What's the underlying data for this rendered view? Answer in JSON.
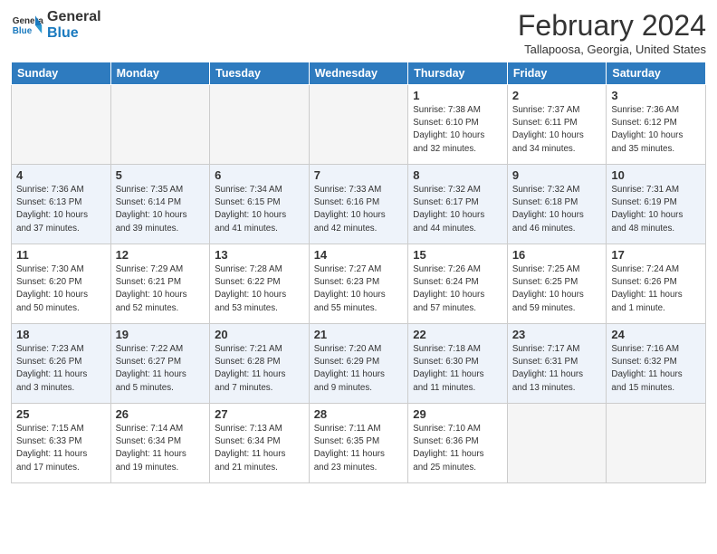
{
  "header": {
    "logo_line1": "General",
    "logo_line2": "Blue",
    "month_title": "February 2024",
    "location": "Tallapoosa, Georgia, United States"
  },
  "days_of_week": [
    "Sunday",
    "Monday",
    "Tuesday",
    "Wednesday",
    "Thursday",
    "Friday",
    "Saturday"
  ],
  "weeks": [
    [
      {
        "day": "",
        "info": ""
      },
      {
        "day": "",
        "info": ""
      },
      {
        "day": "",
        "info": ""
      },
      {
        "day": "",
        "info": ""
      },
      {
        "day": "1",
        "info": "Sunrise: 7:38 AM\nSunset: 6:10 PM\nDaylight: 10 hours\nand 32 minutes."
      },
      {
        "day": "2",
        "info": "Sunrise: 7:37 AM\nSunset: 6:11 PM\nDaylight: 10 hours\nand 34 minutes."
      },
      {
        "day": "3",
        "info": "Sunrise: 7:36 AM\nSunset: 6:12 PM\nDaylight: 10 hours\nand 35 minutes."
      }
    ],
    [
      {
        "day": "4",
        "info": "Sunrise: 7:36 AM\nSunset: 6:13 PM\nDaylight: 10 hours\nand 37 minutes."
      },
      {
        "day": "5",
        "info": "Sunrise: 7:35 AM\nSunset: 6:14 PM\nDaylight: 10 hours\nand 39 minutes."
      },
      {
        "day": "6",
        "info": "Sunrise: 7:34 AM\nSunset: 6:15 PM\nDaylight: 10 hours\nand 41 minutes."
      },
      {
        "day": "7",
        "info": "Sunrise: 7:33 AM\nSunset: 6:16 PM\nDaylight: 10 hours\nand 42 minutes."
      },
      {
        "day": "8",
        "info": "Sunrise: 7:32 AM\nSunset: 6:17 PM\nDaylight: 10 hours\nand 44 minutes."
      },
      {
        "day": "9",
        "info": "Sunrise: 7:32 AM\nSunset: 6:18 PM\nDaylight: 10 hours\nand 46 minutes."
      },
      {
        "day": "10",
        "info": "Sunrise: 7:31 AM\nSunset: 6:19 PM\nDaylight: 10 hours\nand 48 minutes."
      }
    ],
    [
      {
        "day": "11",
        "info": "Sunrise: 7:30 AM\nSunset: 6:20 PM\nDaylight: 10 hours\nand 50 minutes."
      },
      {
        "day": "12",
        "info": "Sunrise: 7:29 AM\nSunset: 6:21 PM\nDaylight: 10 hours\nand 52 minutes."
      },
      {
        "day": "13",
        "info": "Sunrise: 7:28 AM\nSunset: 6:22 PM\nDaylight: 10 hours\nand 53 minutes."
      },
      {
        "day": "14",
        "info": "Sunrise: 7:27 AM\nSunset: 6:23 PM\nDaylight: 10 hours\nand 55 minutes."
      },
      {
        "day": "15",
        "info": "Sunrise: 7:26 AM\nSunset: 6:24 PM\nDaylight: 10 hours\nand 57 minutes."
      },
      {
        "day": "16",
        "info": "Sunrise: 7:25 AM\nSunset: 6:25 PM\nDaylight: 10 hours\nand 59 minutes."
      },
      {
        "day": "17",
        "info": "Sunrise: 7:24 AM\nSunset: 6:26 PM\nDaylight: 11 hours\nand 1 minute."
      }
    ],
    [
      {
        "day": "18",
        "info": "Sunrise: 7:23 AM\nSunset: 6:26 PM\nDaylight: 11 hours\nand 3 minutes."
      },
      {
        "day": "19",
        "info": "Sunrise: 7:22 AM\nSunset: 6:27 PM\nDaylight: 11 hours\nand 5 minutes."
      },
      {
        "day": "20",
        "info": "Sunrise: 7:21 AM\nSunset: 6:28 PM\nDaylight: 11 hours\nand 7 minutes."
      },
      {
        "day": "21",
        "info": "Sunrise: 7:20 AM\nSunset: 6:29 PM\nDaylight: 11 hours\nand 9 minutes."
      },
      {
        "day": "22",
        "info": "Sunrise: 7:18 AM\nSunset: 6:30 PM\nDaylight: 11 hours\nand 11 minutes."
      },
      {
        "day": "23",
        "info": "Sunrise: 7:17 AM\nSunset: 6:31 PM\nDaylight: 11 hours\nand 13 minutes."
      },
      {
        "day": "24",
        "info": "Sunrise: 7:16 AM\nSunset: 6:32 PM\nDaylight: 11 hours\nand 15 minutes."
      }
    ],
    [
      {
        "day": "25",
        "info": "Sunrise: 7:15 AM\nSunset: 6:33 PM\nDaylight: 11 hours\nand 17 minutes."
      },
      {
        "day": "26",
        "info": "Sunrise: 7:14 AM\nSunset: 6:34 PM\nDaylight: 11 hours\nand 19 minutes."
      },
      {
        "day": "27",
        "info": "Sunrise: 7:13 AM\nSunset: 6:34 PM\nDaylight: 11 hours\nand 21 minutes."
      },
      {
        "day": "28",
        "info": "Sunrise: 7:11 AM\nSunset: 6:35 PM\nDaylight: 11 hours\nand 23 minutes."
      },
      {
        "day": "29",
        "info": "Sunrise: 7:10 AM\nSunset: 6:36 PM\nDaylight: 11 hours\nand 25 minutes."
      },
      {
        "day": "",
        "info": ""
      },
      {
        "day": "",
        "info": ""
      }
    ]
  ]
}
